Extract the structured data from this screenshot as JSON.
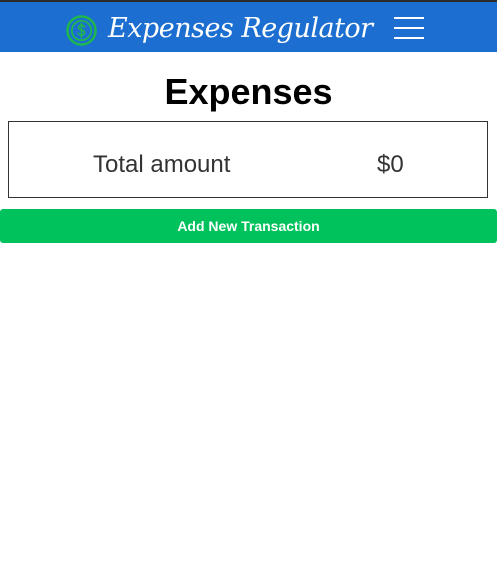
{
  "navbar": {
    "brand_text": "Expenses Regulator",
    "brand_icon": "dollar-coin-icon",
    "menu_icon": "hamburger-menu-icon"
  },
  "main": {
    "title": "Expenses",
    "total": {
      "label": "Total amount",
      "value": "$0"
    },
    "add_button_label": "Add New Transaction"
  },
  "colors": {
    "navbar_bg": "#1c6fd0",
    "brand_icon": "#1fb84a",
    "button_bg": "#00c25c"
  }
}
